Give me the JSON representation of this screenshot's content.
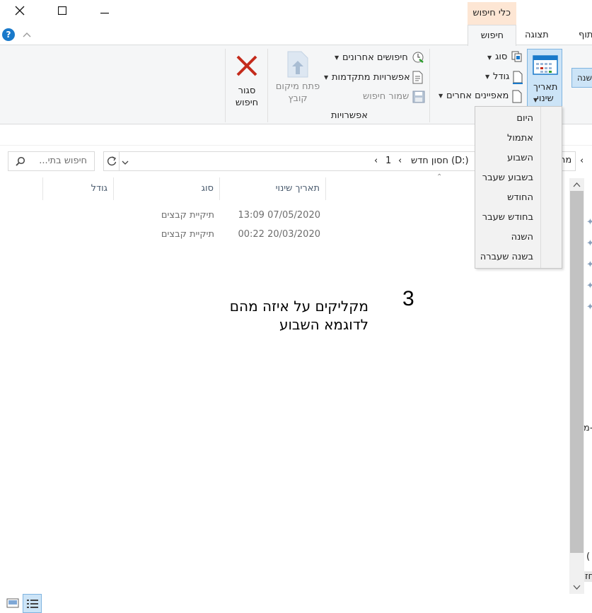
{
  "window": {
    "close_glyph": "✕",
    "maximize_glyph": "☐",
    "minimize_glyph": "—"
  },
  "tabs": {
    "contextual_group": "כלי חיפוש",
    "search_tab": "חיפוש",
    "view_tab": "תצוגה",
    "share_tab_partial": "תוף",
    "help": "?"
  },
  "ribbon": {
    "date_modified_line1": "תאריך",
    "date_modified_line2": "שינוי",
    "kind": "סוג",
    "size": "גודל",
    "other_properties": "מאפיינים אחרים",
    "recent_searches": "חיפושים אחרונים",
    "advanced_options": "אפשרויות מתקדמות",
    "save_search": "שמור חיפוש",
    "options_group": "אפשרויות",
    "open_location_line1": "פתח מיקום",
    "open_location_line2": "קובץ",
    "close_search_line1": "סגור",
    "close_search_line2": "חיפוש",
    "left_partial": "שנה"
  },
  "date_menu": {
    "items": [
      "היום",
      "אתמול",
      "השבוע",
      "בשבוע שעבר",
      "החודש",
      "בחודש שעבר",
      "השנה",
      "בשנה שעברה"
    ]
  },
  "address": {
    "path_partial_left": "חסון חדש (D:)",
    "path_segment": "1",
    "path_partial_right": "מר",
    "search_placeholder": "חיפוש בתי..."
  },
  "columns": {
    "date_modified": "תאריך שינוי",
    "type": "סוג",
    "size": "גודל"
  },
  "rows": [
    {
      "date": "07/05/2020 13:09",
      "type": "תיקיית קבצים"
    },
    {
      "date": "20/03/2020 00:22",
      "type": "תיקיית קבצים"
    }
  ],
  "annotation": {
    "number": "3",
    "line1": "מקליקים  על איזה מהם",
    "line2": "לדוגמא השבוע"
  },
  "right_edge": {
    "partial_mid": "ן-מ",
    "partial_low1": "(",
    "partial_low2": "חז"
  },
  "colors": {
    "accent_blue": "#1979ca",
    "contextual_tab_bg": "#fde6d4",
    "close_red": "#c42b1c"
  }
}
